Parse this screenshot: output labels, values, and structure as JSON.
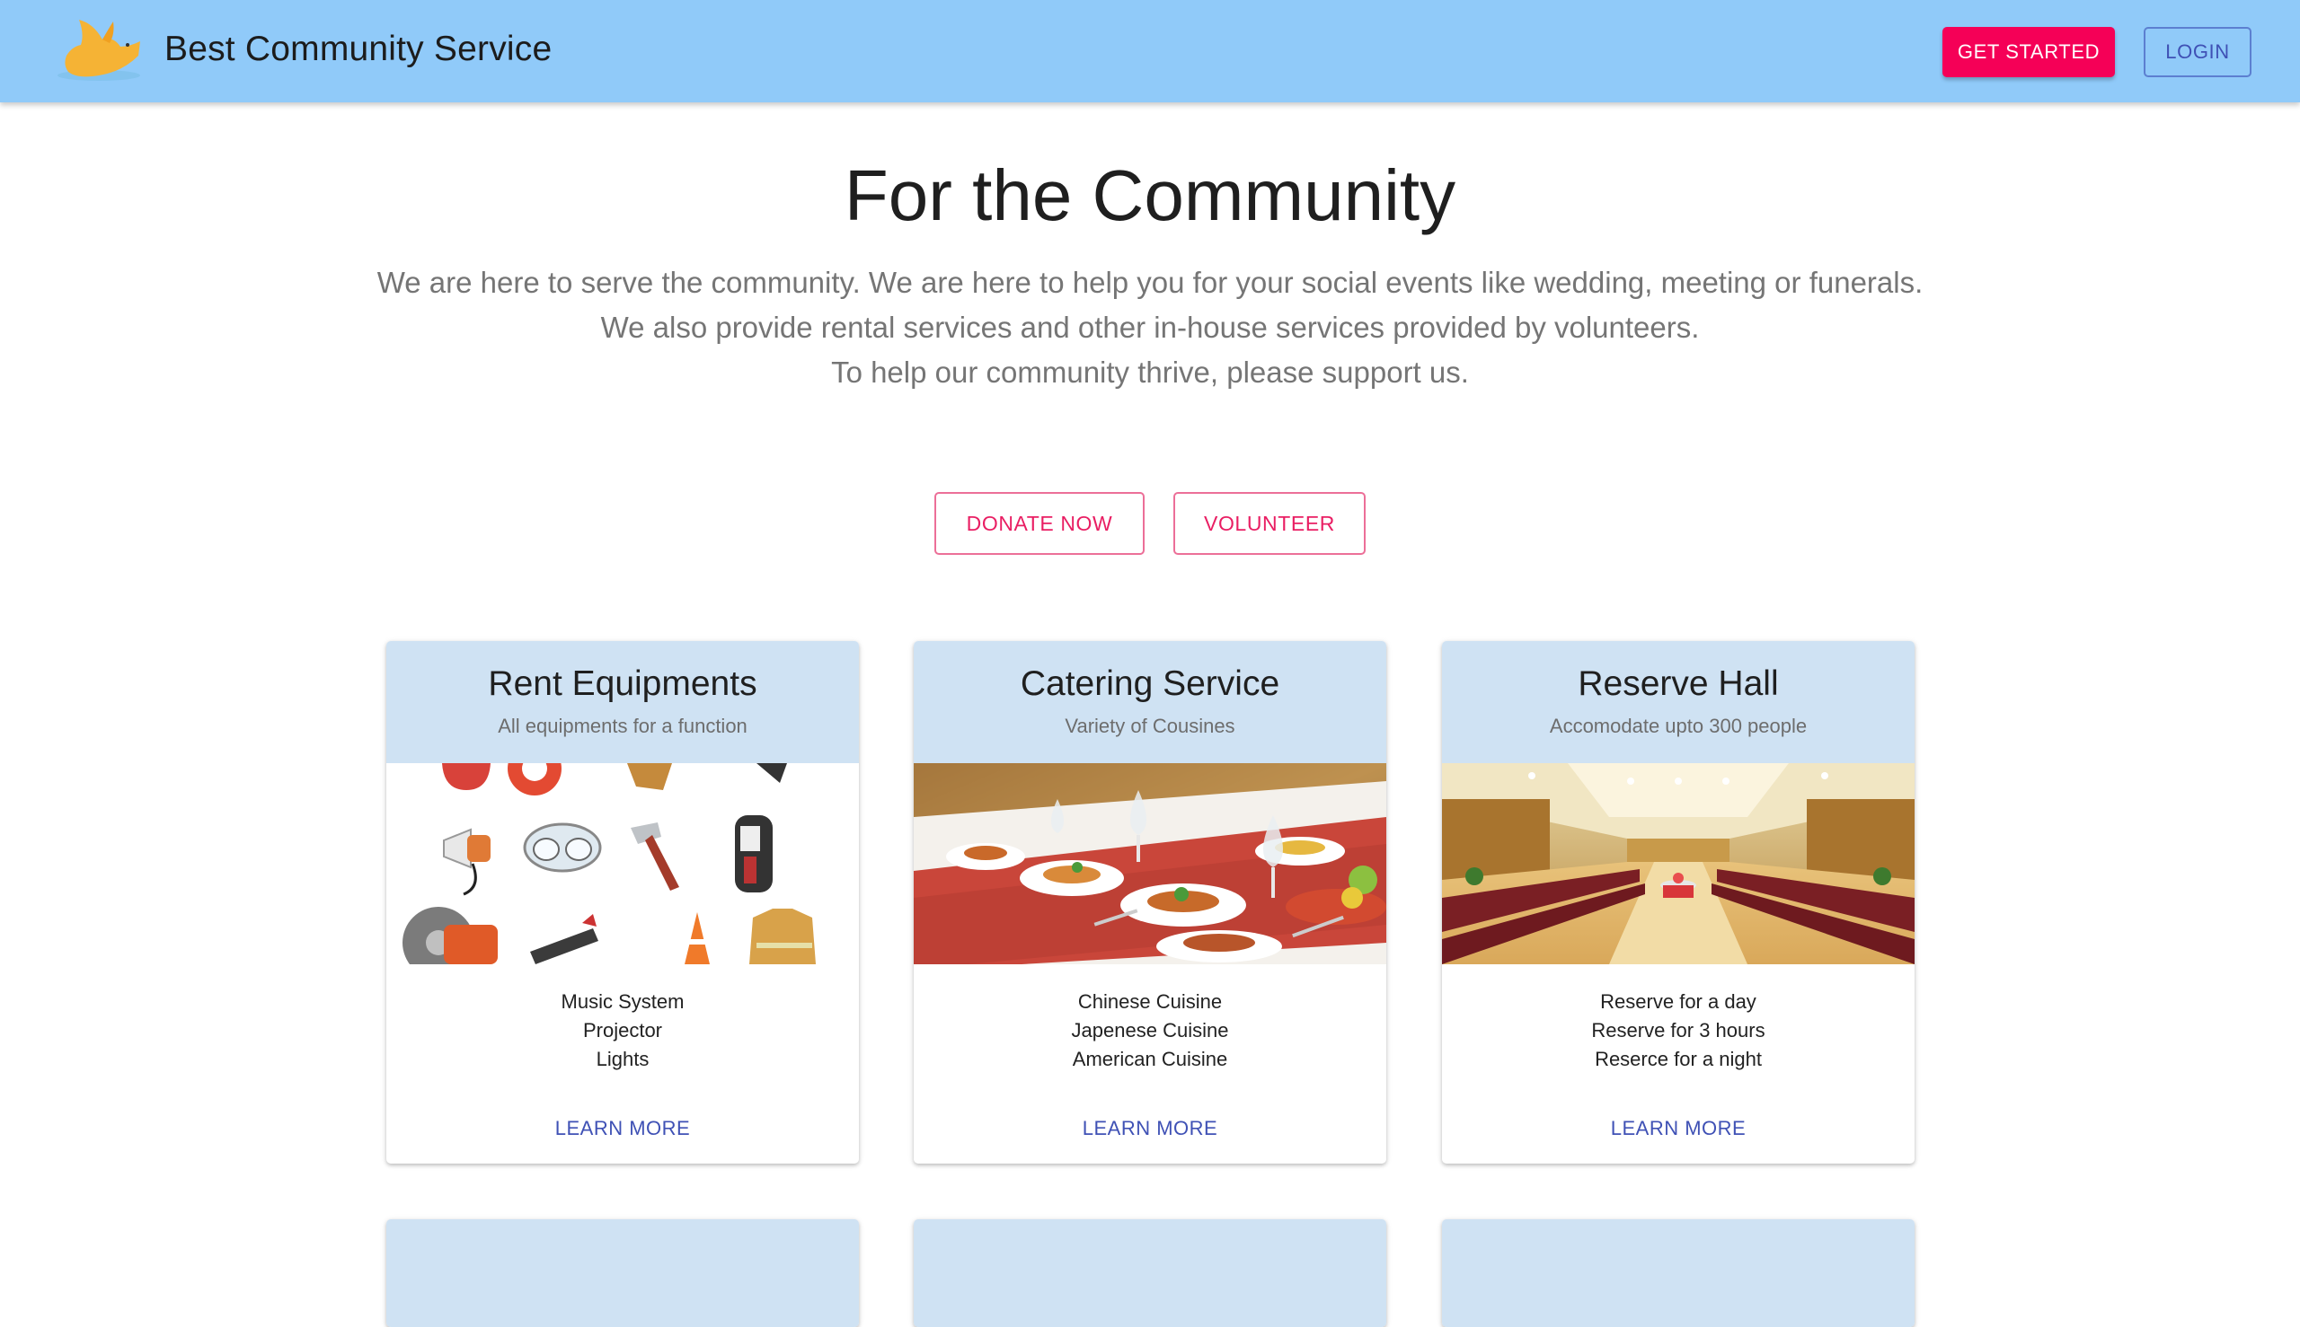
{
  "appbar": {
    "brand": "Best Community Service",
    "get_started_label": "GET STARTED",
    "login_label": "LOGIN",
    "color": "#90caf9"
  },
  "hero": {
    "title": "For the Community",
    "lines": [
      "We are here to serve the community. We are here to help you for your social events like wedding, meeting or funerals.",
      "We also provide rental services and other in-house services provided by volunteers.",
      "To help our community thrive, please support us."
    ],
    "donate_label": "DONATE NOW",
    "volunteer_label": "VOLUNTEER"
  },
  "cards": [
    {
      "title": "Rent Equipments",
      "subtitle": "All equipments for a function",
      "items": [
        "Music System",
        "Projector",
        "Lights"
      ],
      "link": "LEARN MORE",
      "image": "equipment-collage"
    },
    {
      "title": "Catering Service",
      "subtitle": "Variety of Cousines",
      "items": [
        "Chinese Cuisine",
        "Japenese Cuisine",
        "American Cuisine"
      ],
      "link": "LEARN MORE",
      "image": "banquet-table"
    },
    {
      "title": "Reserve Hall",
      "subtitle": "Accomodate upto 300 people",
      "items": [
        "Reserve for a day",
        "Reserve for 3 hours",
        "Reserce for a night"
      ],
      "link": "LEARN MORE",
      "image": "event-hall"
    }
  ],
  "colors": {
    "accent_pink": "#f50057",
    "primary_indigo": "#3f51b5",
    "card_header": "#cfe2f3"
  }
}
